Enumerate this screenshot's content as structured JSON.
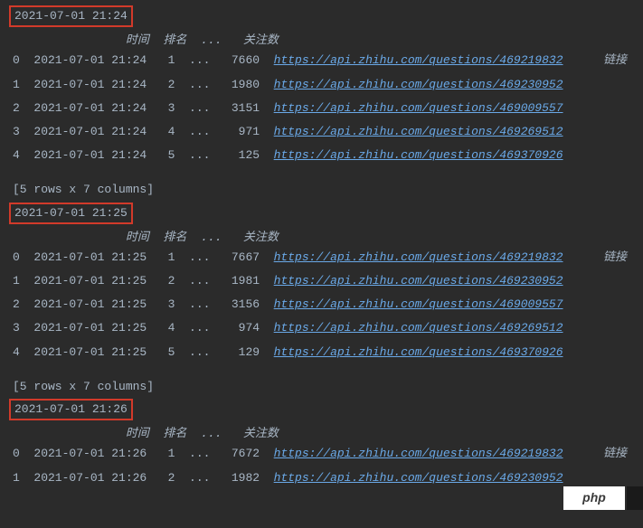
{
  "headers": {
    "time": "时间",
    "rank": "排名",
    "dots": "...",
    "attention": "关注数",
    "link": "链接"
  },
  "footer_text": "[5 rows x 7 columns]",
  "badge": "php",
  "blocks": [
    {
      "timestamp": "2021-07-01 21:24",
      "show_footer": false,
      "rows": [
        {
          "idx": "0",
          "time": "2021-07-01 21:24",
          "rank": "1",
          "dots": "...",
          "attention": "7660",
          "link": "https://api.zhihu.com/questions/469219832"
        },
        {
          "idx": "1",
          "time": "2021-07-01 21:24",
          "rank": "2",
          "dots": "...",
          "attention": "1980",
          "link": "https://api.zhihu.com/questions/469230952"
        },
        {
          "idx": "2",
          "time": "2021-07-01 21:24",
          "rank": "3",
          "dots": "...",
          "attention": "3151",
          "link": "https://api.zhihu.com/questions/469009557"
        },
        {
          "idx": "3",
          "time": "2021-07-01 21:24",
          "rank": "4",
          "dots": "...",
          "attention": "971",
          "link": "https://api.zhihu.com/questions/469269512"
        },
        {
          "idx": "4",
          "time": "2021-07-01 21:24",
          "rank": "5",
          "dots": "...",
          "attention": "125",
          "link": "https://api.zhihu.com/questions/469370926"
        }
      ]
    },
    {
      "timestamp": "2021-07-01 21:25",
      "show_footer": true,
      "rows": [
        {
          "idx": "0",
          "time": "2021-07-01 21:25",
          "rank": "1",
          "dots": "...",
          "attention": "7667",
          "link": "https://api.zhihu.com/questions/469219832"
        },
        {
          "idx": "1",
          "time": "2021-07-01 21:25",
          "rank": "2",
          "dots": "...",
          "attention": "1981",
          "link": "https://api.zhihu.com/questions/469230952"
        },
        {
          "idx": "2",
          "time": "2021-07-01 21:25",
          "rank": "3",
          "dots": "...",
          "attention": "3156",
          "link": "https://api.zhihu.com/questions/469009557"
        },
        {
          "idx": "3",
          "time": "2021-07-01 21:25",
          "rank": "4",
          "dots": "...",
          "attention": "974",
          "link": "https://api.zhihu.com/questions/469269512"
        },
        {
          "idx": "4",
          "time": "2021-07-01 21:25",
          "rank": "5",
          "dots": "...",
          "attention": "129",
          "link": "https://api.zhihu.com/questions/469370926"
        }
      ]
    },
    {
      "timestamp": "2021-07-01 21:26",
      "show_footer": true,
      "rows": [
        {
          "idx": "0",
          "time": "2021-07-01 21:26",
          "rank": "1",
          "dots": "...",
          "attention": "7672",
          "link": "https://api.zhihu.com/questions/469219832"
        },
        {
          "idx": "1",
          "time": "2021-07-01 21:26",
          "rank": "2",
          "dots": "...",
          "attention": "1982",
          "link": "https://api.zhihu.com/questions/469230952"
        }
      ]
    }
  ]
}
